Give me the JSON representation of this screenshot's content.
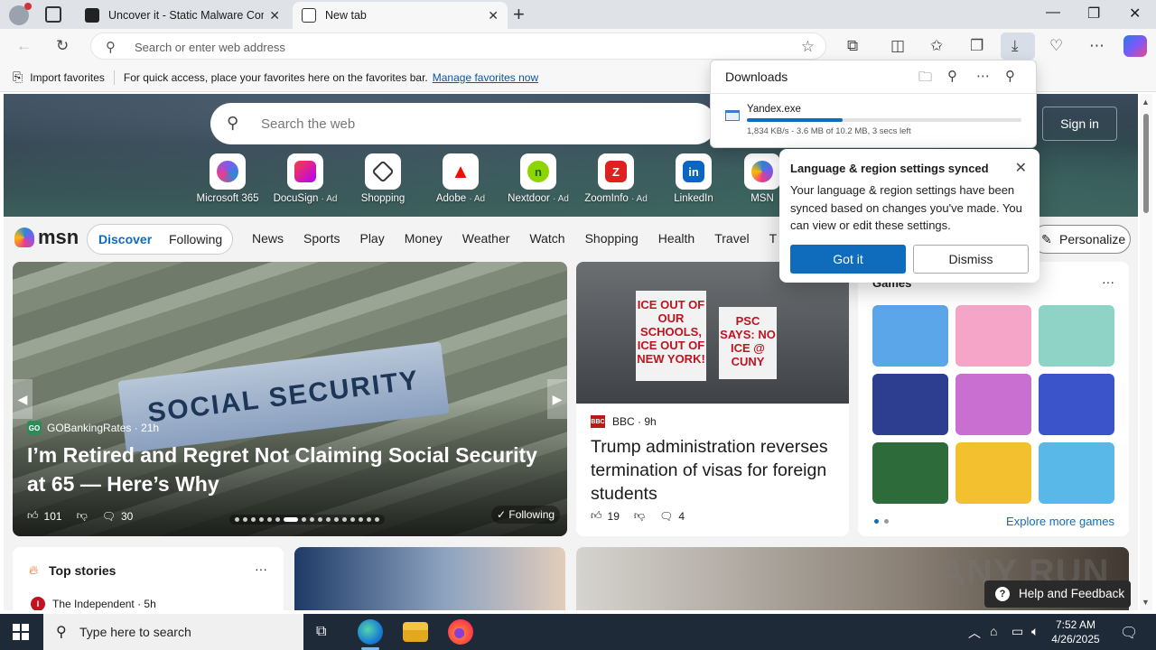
{
  "tabs": [
    {
      "title": "Uncover it - Static Malware Confi",
      "close": "✕"
    },
    {
      "title": "New tab",
      "close": "✕"
    }
  ],
  "window": {
    "minimize": "—",
    "maximize": "❐",
    "close": "✕",
    "new_tab": "+"
  },
  "toolbar": {
    "search_placeholder": "Search or enter web address"
  },
  "favorites_bar": {
    "import_label": "Import favorites",
    "hint": "For quick access, place your favorites here on the favorites bar.",
    "manage_link": "Manage favorites now"
  },
  "hero": {
    "search_placeholder": "Search the web",
    "sign_in": "Sign in",
    "quick_links": [
      {
        "label": "Microsoft 365",
        "ad": ""
      },
      {
        "label": "DocuSign",
        "ad": "· Ad"
      },
      {
        "label": "Shopping",
        "ad": ""
      },
      {
        "label": "Adobe",
        "ad": "· Ad"
      },
      {
        "label": "Nextdoor",
        "ad": "· Ad"
      },
      {
        "label": "ZoomInfo",
        "ad": "· Ad"
      },
      {
        "label": "LinkedIn",
        "ad": ""
      },
      {
        "label": "MSN",
        "ad": ""
      }
    ]
  },
  "msn": {
    "logo": "msn",
    "discover": "Discover",
    "following": "Following",
    "nav": [
      "News",
      "Sports",
      "Play",
      "Money",
      "Weather",
      "Watch",
      "Shopping",
      "Health",
      "Travel",
      "T"
    ],
    "personalize": "Personalize"
  },
  "main_story": {
    "source": "GOBankingRates",
    "source_icon": "GO",
    "age": "21h",
    "headline": "I’m Retired and Regret Not Claiming Social Security at 65 — Here’s Why",
    "likes": "101",
    "comments": "30",
    "following_badge": "Following",
    "image_text": "SOCIAL SECURITY"
  },
  "second_story": {
    "source": "BBC",
    "source_icon": "BBC",
    "age": "9h",
    "headline": "Trump administration reverses termination of visas for foreign students",
    "likes": "19",
    "comments": "4",
    "signs": [
      "ICE OUT OF OUR SCHOOLS, ICE OUT OF NEW YORK!",
      "PSC SAYS: NO ICE @ CUNY"
    ]
  },
  "games": {
    "title": "Games",
    "more": "···",
    "explore": "Explore more games",
    "tiles": [
      "#5aa6e8",
      "#f5a6c8",
      "#8fd3c7",
      "#2d3d8f",
      "#c86fd1",
      "#3b54c9",
      "#2e6b3a",
      "#f3c12f",
      "#59b8e8"
    ]
  },
  "top_stories": {
    "title": "Top stories",
    "more": "···",
    "first_source": "The Independent · 5h",
    "first_icon": "I"
  },
  "downloads": {
    "title": "Downloads",
    "file": "Yandex.exe",
    "progress": 0.35,
    "status": "1,834 KB/s - 3.6 MB of 10.2 MB, 3 secs left"
  },
  "lang_popup": {
    "title": "Language & region settings synced",
    "body": "Your language & region settings have been synced based on changes you've made. You can view or edit these settings.",
    "primary": "Got it",
    "secondary": "Dismiss"
  },
  "help": {
    "label": "Help and Feedback",
    "icon": "?"
  },
  "watermark": "ANY RUN",
  "taskbar": {
    "search_placeholder": "Type here to search",
    "time": "7:52 AM",
    "date": "4/26/2025"
  },
  "colors": {
    "accent": "#0f6cbd",
    "taskbar": "#1f2a38"
  }
}
